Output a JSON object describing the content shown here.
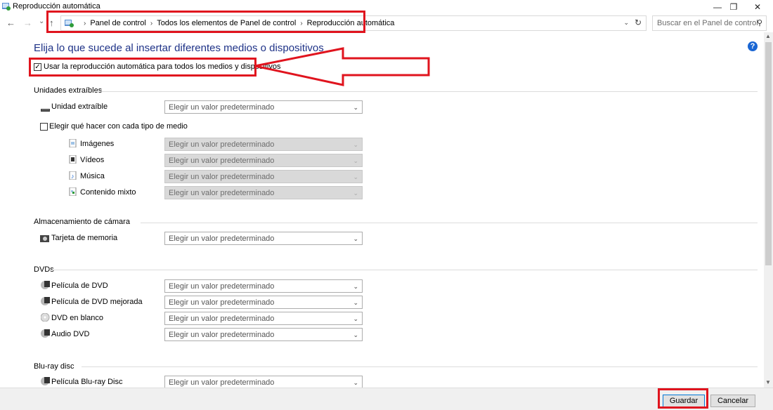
{
  "window": {
    "title": "Reproducción automática",
    "min_glyph": "—",
    "restore_glyph": "❐",
    "close_glyph": "✕"
  },
  "nav": {
    "back_glyph": "←",
    "forward_glyph": "→",
    "recent_glyph": "⌄",
    "up_glyph": "↑"
  },
  "address": {
    "crumbs": [
      "Panel de control",
      "Todos los elementos de Panel de control",
      "Reproducción automática"
    ],
    "separator": "›",
    "dropdown_glyph": "⌄",
    "refresh_glyph": "↻"
  },
  "search": {
    "placeholder": "Buscar en el Panel de control",
    "icon_glyph": "⚲"
  },
  "main": {
    "heading": "Elija lo que sucede al insertar diferentes medios o dispositivos",
    "help_glyph": "?",
    "use_autoplay_label": "Usar la reproducción automática para todos los medios y dispositivos",
    "use_autoplay_checked": true
  },
  "dropdown_default": "Elegir un valor predeterminado",
  "dropdown_arrow": "⌄",
  "removable": {
    "section": "Unidades extraíbles",
    "drive_label": "Unidad extraíble",
    "per_media_label": "Elegir qué hacer con cada tipo de medio",
    "per_media_checked": false,
    "media": [
      {
        "label": "Imágenes"
      },
      {
        "label": "Vídeos"
      },
      {
        "label": "Música"
      },
      {
        "label": "Contenido mixto"
      }
    ]
  },
  "camera": {
    "section": "Almacenamiento de cámara",
    "memory_card_label": "Tarjeta de memoria"
  },
  "dvds": {
    "section": "DVDs",
    "items": [
      {
        "label": "Película de DVD"
      },
      {
        "label": "Película de DVD mejorada"
      },
      {
        "label": "DVD en blanco"
      },
      {
        "label": "Audio DVD"
      }
    ]
  },
  "bluray": {
    "section": "Blu-ray disc",
    "items": [
      {
        "label": "Película Blu-ray Disc"
      }
    ]
  },
  "footer": {
    "save_label": "Guardar",
    "cancel_label": "Cancelar"
  },
  "colors": {
    "annotation_red": "#e0141e",
    "heading_blue": "#1e3287"
  }
}
